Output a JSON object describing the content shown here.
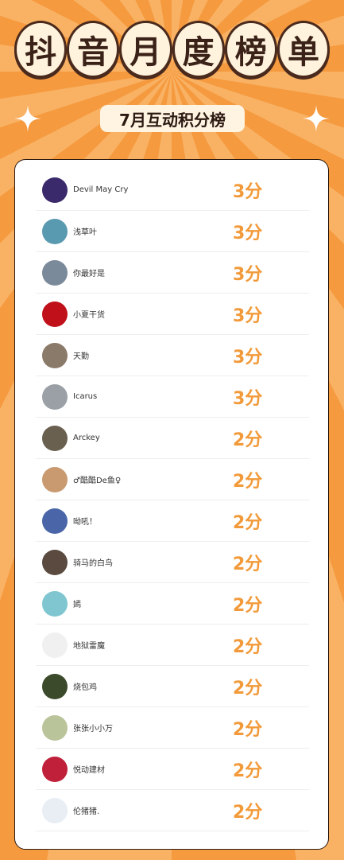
{
  "header": {
    "title_chars": [
      "抖",
      "音",
      "月",
      "度",
      "榜",
      "单"
    ],
    "subtitle": "7月互动积分榜"
  },
  "colors": {
    "background_orange": "#f7a24a",
    "score_orange": "#f29a3a",
    "title_ring": "#4a2a1d",
    "title_fill": "#fff3dd"
  },
  "leaderboard": [
    {
      "name": "Devil May Cry",
      "score": "3分",
      "avatar_icon": "anime-avatar-icon",
      "avatar_color": "#3a2a6b"
    },
    {
      "name": "浅草叶",
      "score": "3分",
      "avatar_icon": "frog-avatar-icon",
      "avatar_color": "#5a9ab0"
    },
    {
      "name": "你最好是",
      "score": "3分",
      "avatar_icon": "cartoon-avatar-icon",
      "avatar_color": "#7a8a9a"
    },
    {
      "name": "小夏干货",
      "score": "3分",
      "avatar_icon": "red-seal-avatar-icon",
      "avatar_color": "#c0101a"
    },
    {
      "name": "天勤",
      "score": "3分",
      "avatar_icon": "photo-avatar-icon",
      "avatar_color": "#8a7a6a"
    },
    {
      "name": "Icarus",
      "score": "3分",
      "avatar_icon": "child-photo-avatar-icon",
      "avatar_color": "#9aa0a6"
    },
    {
      "name": "Arckey",
      "score": "2分",
      "avatar_icon": "couple-photo-avatar-icon",
      "avatar_color": "#6a6050"
    },
    {
      "name": "♂酷酷De鱼♀",
      "score": "2分",
      "avatar_icon": "face-avatar-icon",
      "avatar_color": "#c99a70"
    },
    {
      "name": "呦吼！",
      "score": "2分",
      "avatar_icon": "stamp-avatar-icon",
      "avatar_color": "#4a66a8"
    },
    {
      "name": "骑马的白鸟",
      "score": "2分",
      "avatar_icon": "portrait-avatar-icon",
      "avatar_color": "#5a4a40"
    },
    {
      "name": "嫣",
      "score": "2分",
      "avatar_icon": "teal-bird-avatar-icon",
      "avatar_color": "#7fc6d0"
    },
    {
      "name": "地狱雷魔",
      "score": "2分",
      "avatar_icon": "meme-face-avatar-icon",
      "avatar_color": "#f0f0f0"
    },
    {
      "name": "烧包鸡",
      "score": "2分",
      "avatar_icon": "meme-photo-avatar-icon",
      "avatar_color": "#3a4a2a"
    },
    {
      "name": "张张小小万",
      "score": "2分",
      "avatar_icon": "shiba-avatar-icon",
      "avatar_color": "#b9c49a"
    },
    {
      "name": "悦动建材",
      "score": "2分",
      "avatar_icon": "bowl-avatar-icon",
      "avatar_color": "#c0203a"
    },
    {
      "name": "伦猪猪.",
      "score": "2分",
      "avatar_icon": "astronaut-avatar-icon",
      "avatar_color": "#e8eef4"
    }
  ]
}
